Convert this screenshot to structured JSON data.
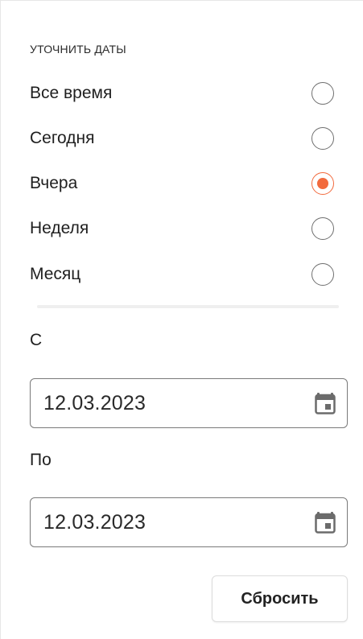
{
  "filter": {
    "section_title": "УТОЧНИТЬ ДАТЫ",
    "accent_color": "#f26a3d",
    "selected_option": "Вчера",
    "options": [
      {
        "label": "Все время",
        "selected": false
      },
      {
        "label": "Сегодня",
        "selected": false
      },
      {
        "label": "Вчера",
        "selected": true
      },
      {
        "label": "Неделя",
        "selected": false
      },
      {
        "label": "Месяц",
        "selected": false
      }
    ]
  },
  "range": {
    "from_label": "С",
    "from_value": "12.03.2023",
    "to_label": "По",
    "to_value": "12.03.2023",
    "icon": "calendar-icon"
  },
  "actions": {
    "reset_label": "Сбросить"
  }
}
